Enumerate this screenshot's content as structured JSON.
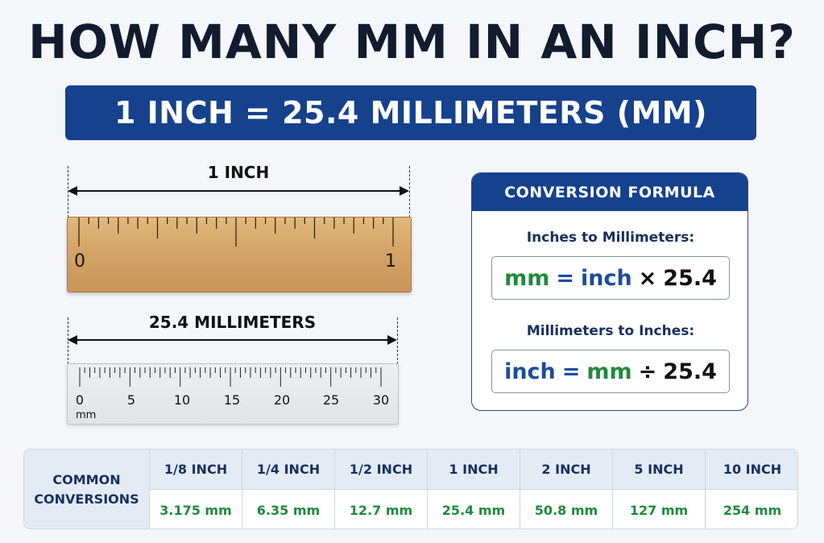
{
  "title": "HOW MANY MM IN AN INCH?",
  "banner": "1 INCH = 25.4 MILLIMETERS (MM)",
  "inch_ruler": {
    "label": "1 INCH",
    "start_label": "0",
    "end_label": "1"
  },
  "mm_ruler": {
    "label": "25.4 MILLIMETERS",
    "numbers": [
      "0",
      "5",
      "10",
      "15",
      "20",
      "25",
      "30"
    ],
    "unit": "mm"
  },
  "formula": {
    "heading": "CONVERSION FORMULA",
    "to_mm_label": "Inches to Millimeters:",
    "to_mm": {
      "lhs": "mm",
      "eq": "=",
      "var": "inch",
      "op": "×",
      "factor": "25.4"
    },
    "to_inch_label": "Millimeters to Inches:",
    "to_inch": {
      "lhs": "inch",
      "eq": "=",
      "var": "mm",
      "op": "÷",
      "factor": "25.4"
    }
  },
  "conversions": {
    "label_line1": "COMMON",
    "label_line2": "CONVERSIONS",
    "columns": [
      {
        "inch": "1/8 INCH",
        "mm": "3.175 mm"
      },
      {
        "inch": "1/4 INCH",
        "mm": "6.35 mm"
      },
      {
        "inch": "1/2 INCH",
        "mm": "12.7 mm"
      },
      {
        "inch": "1 INCH",
        "mm": "25.4 mm"
      },
      {
        "inch": "2 INCH",
        "mm": "50.8 mm"
      },
      {
        "inch": "5 INCH",
        "mm": "127 mm"
      },
      {
        "inch": "10 INCH",
        "mm": "254 mm"
      }
    ]
  },
  "colors": {
    "brand_blue": "#16418c",
    "mm_green": "#1f8a3b",
    "inch_blue": "#1c4d9e"
  }
}
